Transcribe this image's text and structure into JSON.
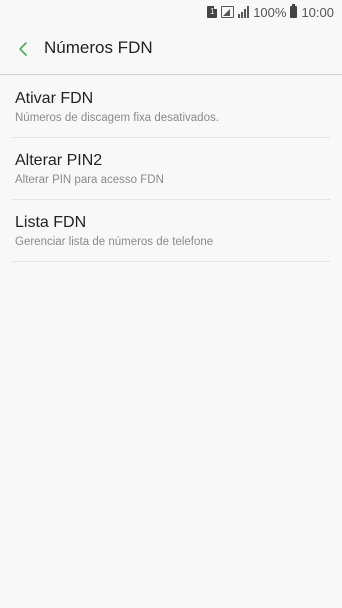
{
  "status_bar": {
    "sim_label": "1",
    "battery_percent": "100%",
    "time": "10:00",
    "icons": [
      "sim-icon",
      "wifi-calling-icon",
      "signal-icon",
      "battery-icon"
    ]
  },
  "app_bar": {
    "title": "Números FDN",
    "back_icon": "chevron-left-icon",
    "accent_color": "#4caf50"
  },
  "settings": {
    "items": [
      {
        "title": "Ativar FDN",
        "subtitle": "Números de discagem fixa desativados."
      },
      {
        "title": "Alterar PIN2",
        "subtitle": "Alterar PIN para acesso FDN"
      },
      {
        "title": "Lista FDN",
        "subtitle": "Gerenciar lista de números de telefone"
      }
    ]
  }
}
